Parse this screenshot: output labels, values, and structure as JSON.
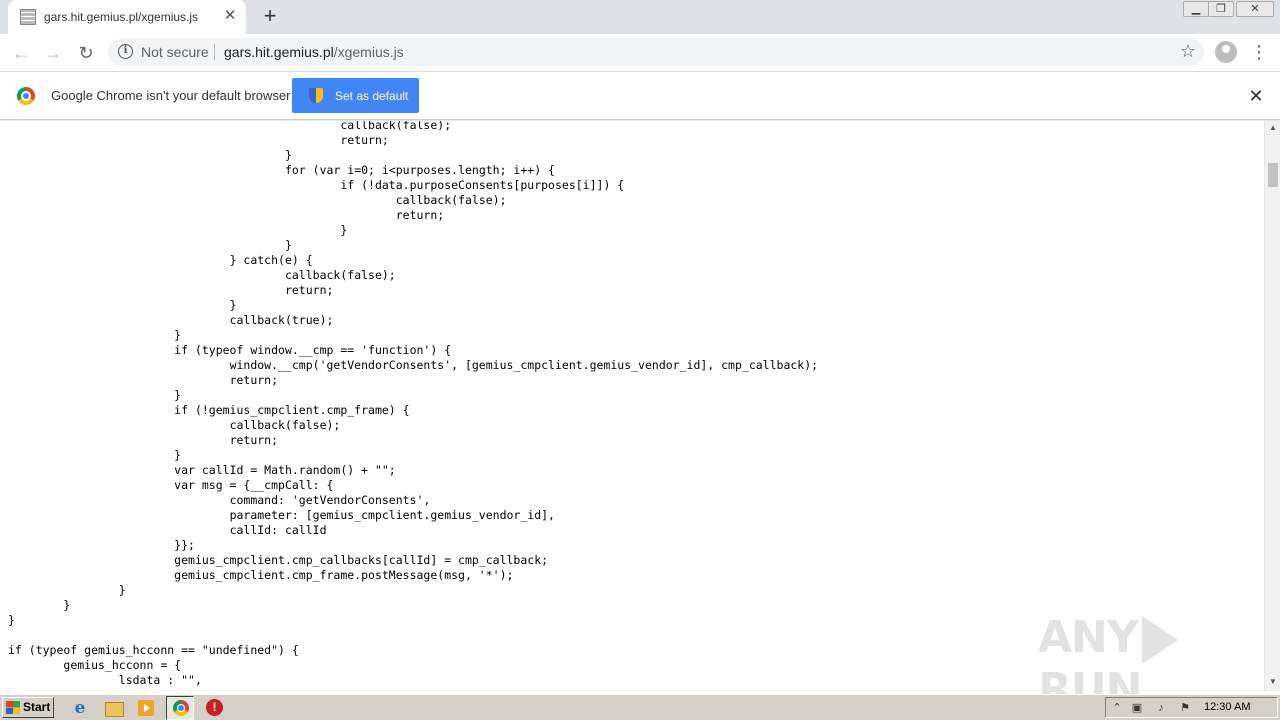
{
  "tab": {
    "title": "gars.hit.gemius.pl/xgemius.js",
    "close_glyph": "✕"
  },
  "new_tab_glyph": "+",
  "toolbar": {
    "security_label": "Not secure",
    "url_host": "gars.hit.gemius.pl",
    "url_path": "/xgemius.js"
  },
  "infobar": {
    "message": "Google Chrome isn't your default browser",
    "button_label": "Set as default"
  },
  "code_lines": [
    "\t\t\t\t\t\tcallback(false);",
    "\t\t\t\t\t\treturn;",
    "\t\t\t\t\t}",
    "\t\t\t\t\tfor (var i=0; i<purposes.length; i++) {",
    "\t\t\t\t\t\tif (!data.purposeConsents[purposes[i]]) {",
    "\t\t\t\t\t\t\tcallback(false);",
    "\t\t\t\t\t\t\treturn;",
    "\t\t\t\t\t\t}",
    "\t\t\t\t\t}",
    "\t\t\t\t} catch(e) {",
    "\t\t\t\t\tcallback(false);",
    "\t\t\t\t\treturn;",
    "\t\t\t\t}",
    "\t\t\t\tcallback(true);",
    "\t\t\t}",
    "\t\t\tif (typeof window.__cmp == 'function') {",
    "\t\t\t\twindow.__cmp('getVendorConsents', [gemius_cmpclient.gemius_vendor_id], cmp_callback);",
    "\t\t\t\treturn;",
    "\t\t\t}",
    "\t\t\tif (!gemius_cmpclient.cmp_frame) {",
    "\t\t\t\tcallback(false);",
    "\t\t\t\treturn;",
    "\t\t\t}",
    "\t\t\tvar callId = Math.random() + \"\";",
    "\t\t\tvar msg = {__cmpCall: {",
    "\t\t\t\tcommand: 'getVendorConsents',",
    "\t\t\t\tparameter: [gemius_cmpclient.gemius_vendor_id],",
    "\t\t\t\tcallId: callId",
    "\t\t\t}};",
    "\t\t\tgemius_cmpclient.cmp_callbacks[callId] = cmp_callback;",
    "\t\t\tgemius_cmpclient.cmp_frame.postMessage(msg, '*');",
    "\t\t}",
    "\t}",
    "}",
    "",
    "if (typeof gemius_hcconn == \"undefined\") {",
    "\tgemius_hcconn = {",
    "\t\tlsdata : \"\","
  ],
  "watermark": {
    "left": "ANY",
    "right": "RUN"
  },
  "taskbar": {
    "start_label": "Start",
    "clock": "12:30 AM"
  },
  "icons": {
    "back": "arrow-left-icon",
    "forward": "arrow-right-icon",
    "reload": "reload-icon",
    "info": "info-icon",
    "bookmark": "star-icon",
    "profile": "avatar-icon",
    "menu": "kebab-menu-icon",
    "infobar_close": "close-icon"
  },
  "colors": {
    "accent": "#4285f4",
    "tabstrip": "#dee1e6",
    "taskbar": "#d4d0c8"
  }
}
